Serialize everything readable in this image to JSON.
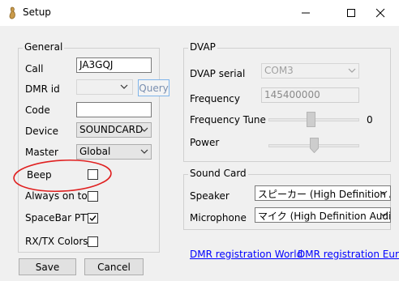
{
  "window": {
    "title": "Setup"
  },
  "general": {
    "legend": "General",
    "call_label": "Call",
    "call_value": "JA3GQJ",
    "dmrid_label": "DMR id",
    "dmrid_value": "",
    "query_label": "Query",
    "code_label": "Code",
    "code_value": "",
    "device_label": "Device",
    "device_value": "SOUNDCARD",
    "master_label": "Master",
    "master_value": "Global",
    "beep_label": "Beep",
    "beep_checked": false,
    "always_on_top_label": "Always on top",
    "always_on_top_checked": false,
    "spacebar_ptt_label": "SpaceBar PTT",
    "spacebar_ptt_checked": true,
    "rxtx_colors_label": "RX/TX Colors",
    "rxtx_colors_checked": false
  },
  "dvap": {
    "legend": "DVAP",
    "serial_label": "DVAP serial",
    "serial_value": "COM3",
    "frequency_label": "Frequency",
    "frequency_value": "145400000",
    "freq_tune_label": "Frequency Tune",
    "freq_tune_value": "0",
    "power_label": "Power"
  },
  "sound": {
    "legend": "Sound Card",
    "speaker_label": "Speaker",
    "speaker_value": "スピーカー (High Definition A",
    "microphone_label": "Microphone",
    "microphone_value": "マイク (High Definition Audio"
  },
  "links": {
    "world": "DMR registration World",
    "europe": "DMR registration Europe"
  },
  "buttons": {
    "save": "Save",
    "cancel": "Cancel"
  },
  "annotation": {
    "color": "#e02020"
  }
}
